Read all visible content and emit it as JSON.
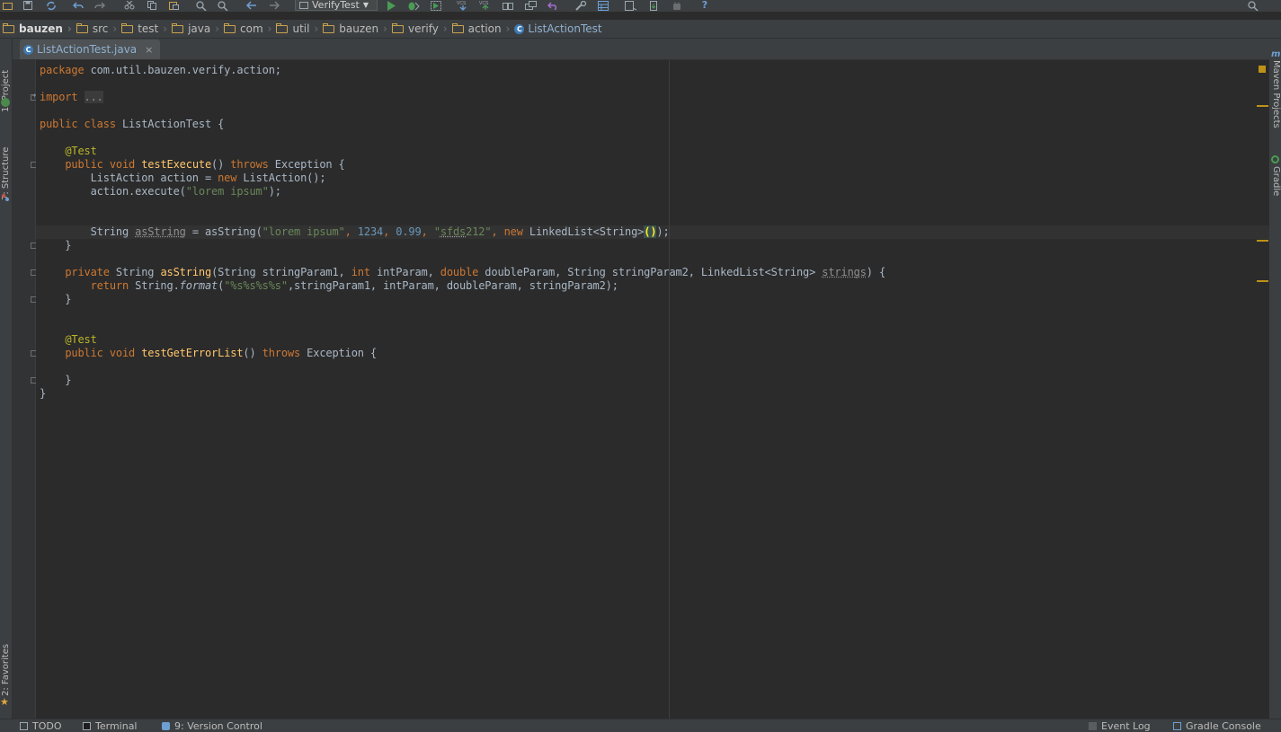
{
  "toolbar": {
    "run_config": "VerifyTest",
    "help": "?",
    "vcs_update": "VCS",
    "vcs_commit": "VCS"
  },
  "breadcrumb": {
    "items": [
      "bauzen",
      "src",
      "test",
      "java",
      "com",
      "util",
      "bauzen",
      "verify",
      "action"
    ],
    "current": "ListActionTest"
  },
  "left_tool_windows": {
    "project": "1: Project",
    "structure": "7: Structure",
    "favorites": "2: Favorites"
  },
  "right_tool_windows": {
    "maven": "Maven Projects",
    "gradle": "Gradle"
  },
  "editor": {
    "tab_name": "ListActionTest.java",
    "close": "×"
  },
  "code": {
    "package_kw": "package",
    "package_name": " com.util.bauzen.verify.action;",
    "import_kw": "import",
    "import_fold": "...",
    "class_mods": "public class",
    "class_name": " ListActionTest {",
    "test1_ann": "@Test",
    "test1_mods": "public void",
    "test1_name": "testExecute",
    "test1_throws_kw": "throws",
    "test1_throws": " Exception {",
    "line_decl_type": "ListAction action = ",
    "new_kw": "new",
    "line_decl_ctor": " ListAction();",
    "line_exec_pre": "action.execute(",
    "line_exec_str": "\"lorem ipsum\"",
    "line_exec_post": ");",
    "line_asstr_type": "String ",
    "line_asstr_var": "asString",
    "line_asstr_eq": " = asString(",
    "line_asstr_s1": "\"lorem ipsum\"",
    "line_asstr_n1": "1234",
    "line_asstr_n2": "0.99",
    "line_asstr_q": "\"",
    "line_asstr_s2": "sfds",
    "line_asstr_s2b": "212\"",
    "line_asstr_new": "new",
    "line_asstr_ll": " LinkedList<String>",
    "line_asstr_parens": "()",
    "line_asstr_end": ");",
    "method2_kw": "private",
    "method2_ret": " String ",
    "method2_name": "asString",
    "method2_p1": "(String stringParam1, ",
    "method2_int": "int",
    "method2_p2": " intParam, ",
    "method2_double": "double",
    "method2_p3": " doubleParam, String stringParam2, LinkedList<String> ",
    "method2_unused": "strings",
    "method2_close": ") {",
    "return_kw": "return",
    "return_cls": " String.",
    "return_fn": "format",
    "return_fmt": "\"%s%s%s%s\"",
    "return_args": ",stringParam1, intParam, doubleParam, stringParam2);",
    "test2_ann": "@Test",
    "test2_mods": "public void",
    "test2_name": "testGetErrorList",
    "test2_paren": "() ",
    "test2_throws_kw": "throws",
    "test2_throws": " Exception {"
  },
  "statusbar": {
    "todo": "TODO",
    "terminal": "Terminal",
    "vcs": "9: Version Control",
    "event_log": "Event Log",
    "gradle_console": "Gradle Console"
  }
}
